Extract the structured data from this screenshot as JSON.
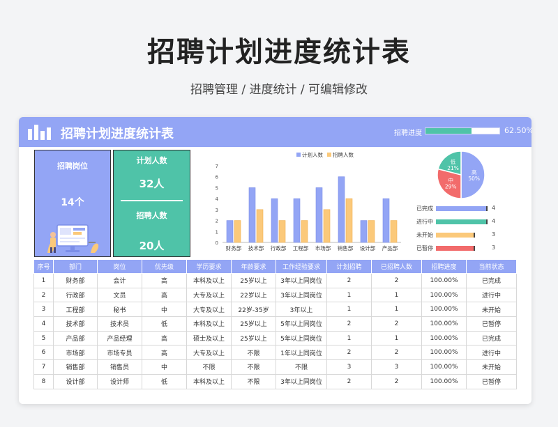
{
  "main_title": "招聘计划进度统计表",
  "sub_title": "招聘管理 /  进度统计  /  可编辑修改",
  "card": {
    "title": "招聘计划进度统计表",
    "progress_label": "招聘进度",
    "progress_value": 0.625,
    "progress_text": "62.50%"
  },
  "summary": {
    "positions_label": "招聘岗位",
    "positions_value": "14个",
    "planned_label": "计划人数",
    "planned_value": "32人",
    "hired_label": "招聘人数",
    "hired_value": "20人"
  },
  "chart_data": [
    {
      "type": "bar",
      "categories": [
        "财务部",
        "技术部",
        "行政部",
        "工程部",
        "市场部",
        "销售部",
        "设计部",
        "产品部"
      ],
      "series": [
        {
          "name": "计划人数",
          "values": [
            2,
            5,
            4,
            4,
            5,
            6,
            2,
            4
          ],
          "color": "#93a5f5"
        },
        {
          "name": "招聘人数",
          "values": [
            2,
            3,
            2,
            2,
            3,
            4,
            2,
            2
          ],
          "color": "#fbc97a"
        }
      ],
      "ylim": [
        0,
        7
      ],
      "yticks": [
        "0",
        "1",
        "2",
        "3",
        "4",
        "5",
        "6",
        "7"
      ],
      "legend": "top"
    },
    {
      "type": "pie",
      "slices": [
        {
          "label": "高",
          "pct": "50%",
          "value": 50,
          "color": "#93a5f5"
        },
        {
          "label": "中",
          "pct": "29%",
          "value": 29,
          "color": "#f26b6b"
        },
        {
          "label": "低",
          "pct": "21%",
          "value": 21,
          "color": "#4fc3a8"
        }
      ]
    },
    {
      "type": "bar",
      "orientation": "horizontal",
      "categories": [
        "已完成",
        "进行中",
        "未开始",
        "已暂停"
      ],
      "values": [
        4,
        4,
        3,
        3
      ],
      "colors": [
        "#93a5f5",
        "#4fc3a8",
        "#fbc97a",
        "#f26b6b"
      ]
    }
  ],
  "status": [
    {
      "label": "已完成",
      "value": "4",
      "num": 4,
      "color": "#93a5f5"
    },
    {
      "label": "进行中",
      "value": "4",
      "num": 4,
      "color": "#4fc3a8"
    },
    {
      "label": "未开始",
      "value": "3",
      "num": 3,
      "color": "#fbc97a"
    },
    {
      "label": "已暂停",
      "value": "3",
      "num": 3,
      "color": "#f26b6b"
    }
  ],
  "table": {
    "headers": [
      "序号",
      "部门",
      "岗位",
      "优先级",
      "学历要求",
      "年龄要求",
      "工作经验要求",
      "计划招聘",
      "已招聘人数",
      "招聘进度",
      "当前状态"
    ],
    "rows": [
      [
        "1",
        "财务部",
        "会计",
        "高",
        "本科及以上",
        "25岁以上",
        "3年以上同岗位",
        "2",
        "2",
        "100.00%",
        "已完成"
      ],
      [
        "2",
        "行政部",
        "文员",
        "高",
        "大专及以上",
        "22岁以上",
        "3年以上同岗位",
        "1",
        "1",
        "100.00%",
        "进行中"
      ],
      [
        "3",
        "工程部",
        "秘书",
        "中",
        "大专及以上",
        "22岁-35岁",
        "3年以上",
        "1",
        "1",
        "100.00%",
        "未开始"
      ],
      [
        "4",
        "技术部",
        "技术员",
        "低",
        "本科及以上",
        "25岁以上",
        "5年以上同岗位",
        "2",
        "2",
        "100.00%",
        "已暂停"
      ],
      [
        "5",
        "产品部",
        "产品经理",
        "高",
        "硕士及以上",
        "25岁以上",
        "5年以上同岗位",
        "1",
        "1",
        "100.00%",
        "已完成"
      ],
      [
        "6",
        "市场部",
        "市场专员",
        "高",
        "大专及以上",
        "不限",
        "1年以上同岗位",
        "2",
        "2",
        "100.00%",
        "进行中"
      ],
      [
        "7",
        "销售部",
        "销售员",
        "中",
        "不限",
        "不限",
        "不限",
        "3",
        "3",
        "100.00%",
        "未开始"
      ],
      [
        "8",
        "设计部",
        "设计师",
        "低",
        "本科及以上",
        "不限",
        "3年以上同岗位",
        "2",
        "2",
        "100.00%",
        "已暂停"
      ]
    ]
  }
}
